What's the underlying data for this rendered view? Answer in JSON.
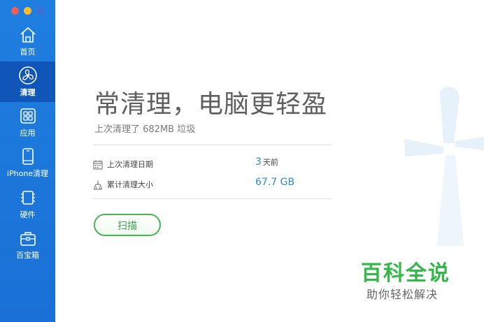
{
  "window_controls": {
    "close_color": "#f25f58",
    "minimize_color": "#fbbd2e",
    "zoom_color": "#3b6fd2"
  },
  "sidebar": {
    "items": [
      {
        "label": "首页",
        "icon": "home-icon",
        "active": false
      },
      {
        "label": "清理",
        "icon": "fan-icon",
        "active": true
      },
      {
        "label": "应用",
        "icon": "apps-icon",
        "active": false
      },
      {
        "label": "iPhone清理",
        "icon": "iphone-icon",
        "active": false
      },
      {
        "label": "硬件",
        "icon": "chip-icon",
        "active": false
      },
      {
        "label": "百宝箱",
        "icon": "toolbox-icon",
        "active": false
      }
    ]
  },
  "main": {
    "title": "常清理，电脑更轻盈",
    "subtitle": "上次清理了 682MB 垃圾",
    "stats": [
      {
        "label": "上次清理日期",
        "icon": "calendar-icon",
        "value": "3",
        "unit": "天前"
      },
      {
        "label": "累计清理大小",
        "icon": "broom-icon",
        "value": "67.7 GB",
        "unit": ""
      }
    ],
    "scan_button": "扫描"
  },
  "watermark": {
    "line1": "百科全说",
    "line2": "助你轻松解决"
  },
  "colors": {
    "sidebar": "#1f7fe0",
    "sidebar_active": "#0f56b8",
    "accent_blue": "#2a8ad4",
    "scan_green": "#4cb358"
  }
}
